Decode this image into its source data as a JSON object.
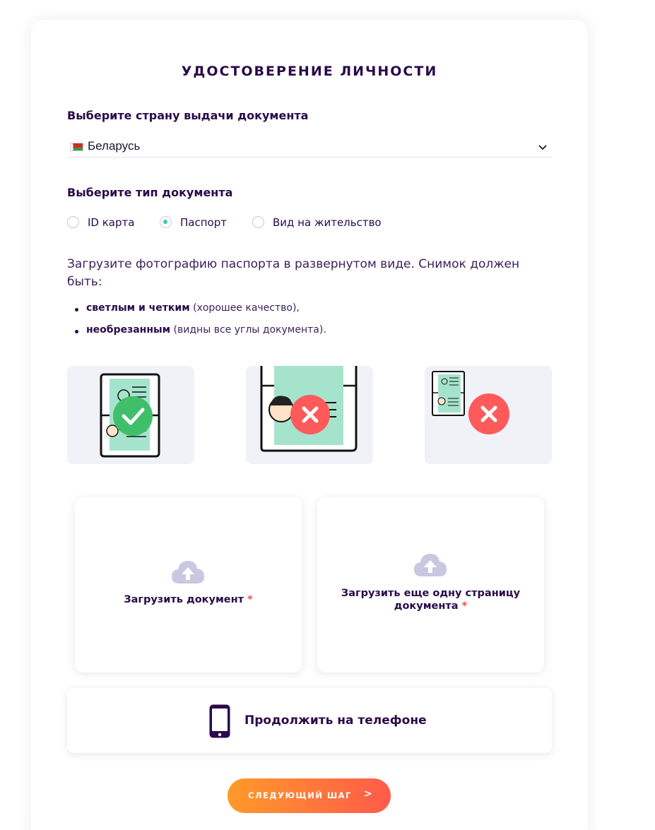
{
  "form": {
    "title": "УДОСТОВЕРЕНИЕ ЛИЧНОСТИ",
    "country_label": "Выберите страну выдачи документа",
    "country_value": "Беларусь",
    "doc_type_label": "Выберите тип документа",
    "doc_types": [
      {
        "label": "ID карта",
        "selected": false
      },
      {
        "label": "Паспорт",
        "selected": true
      },
      {
        "label": "Вид на жительство",
        "selected": false
      }
    ],
    "instructions": "Загрузите фотографию паспорта в развернутом виде. Снимок должен быть:",
    "bullets": [
      {
        "bold": "светлым и четким",
        "rest": " (хорошее качество),"
      },
      {
        "bold": "необрезанным",
        "rest": " (видны все углы документа)."
      }
    ],
    "examples": [
      {
        "icon": "check-icon",
        "status": "good"
      },
      {
        "icon": "cross-icon",
        "status": "bad"
      },
      {
        "icon": "cross-icon",
        "status": "bad"
      }
    ],
    "upload_primary": {
      "label": "Загрузить документ",
      "required_mark": "*"
    },
    "upload_secondary": {
      "label": "Загрузить еще одну страницу документа",
      "required_mark": "*"
    },
    "phone_button": "Продолжить на телефоне",
    "next_button": {
      "label": "СЛЕДУЮЩИЙ ШАГ",
      "arrow": ">"
    }
  },
  "colors": {
    "primary_text": "#2a0a4a",
    "accent_teal": "#3cc8c2",
    "good_green": "#3fbf6a",
    "bad_red": "#ff5a5a",
    "required": "#ff4b4b",
    "button_gradient_start": "#ff9a2a",
    "button_gradient_end": "#ff5a4a",
    "upload_icon": "#c9c8e0"
  }
}
